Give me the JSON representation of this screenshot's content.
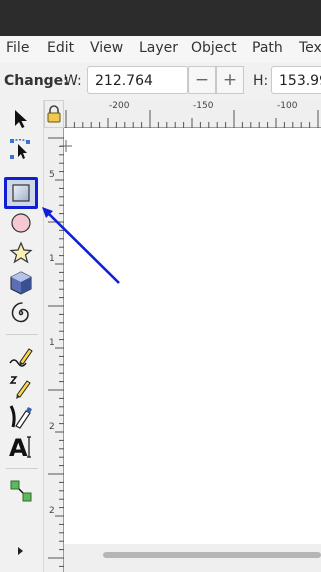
{
  "menu": {
    "file": "File",
    "edit": "Edit",
    "view": "View",
    "layer": "Layer",
    "object": "Object",
    "path": "Path",
    "text": "Tex"
  },
  "controls": {
    "change_label": "Change:",
    "w_label": "W:",
    "w_value": "212.764",
    "minus": "−",
    "plus": "+",
    "h_label": "H:",
    "h_value": "153.99"
  },
  "ruler": {
    "h_labels": [
      "-200",
      "-150",
      "-100"
    ],
    "v_labels": [
      "5",
      "1",
      "1",
      "2",
      "2"
    ]
  },
  "tools": [
    "selector-tool",
    "node-tool",
    "rectangle-tool",
    "ellipse-tool",
    "star-tool",
    "3d-box-tool",
    "spiral-tool",
    "pencil-tool",
    "pen-tool",
    "calligraphy-tool",
    "text-tool",
    "connector-tool"
  ],
  "colors": {
    "highlight": "#0f1fd6",
    "titlebar": "#2c2c2c",
    "canvas": "#ffffff"
  },
  "annotation": {
    "target": "rectangle-tool"
  }
}
